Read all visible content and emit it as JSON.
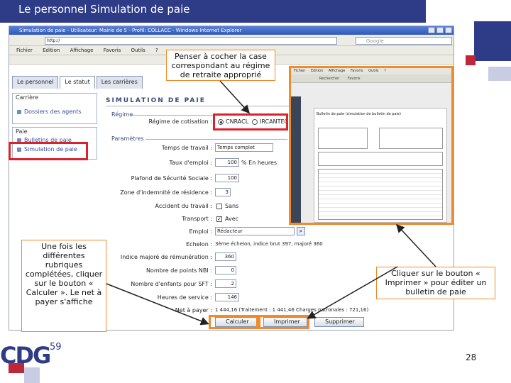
{
  "slide": {
    "title": "Le personnel  Simulation de paie",
    "page_number": "28"
  },
  "browser": {
    "window_title": "Simulation de paie - Utilisateur: Mairie de 5 - Profil: COLLACC - Windows Internet Explorer",
    "address": "http://",
    "search_placeholder": "Google",
    "menu": [
      "Fichier",
      "Edition",
      "Affichage",
      "Favoris",
      "Outils",
      "?"
    ]
  },
  "tabs": [
    "Le personnel",
    "Le statut",
    "Les carrières"
  ],
  "sidebar": {
    "carriere_legend": "Carrière",
    "carriere_link": "Dossiers des agents",
    "paie_legend": "Paie",
    "paie_link1": "Bulletins de paie",
    "paie_link2": "Simulation de paie"
  },
  "form": {
    "main_title": "SIMULATION DE PAIE",
    "regime_section": "Régime",
    "regime_label": "Régime de cotisation :",
    "regime_options": [
      "CNRACL",
      "IRCANTEC"
    ],
    "params_section": "Paramètres",
    "fields": {
      "temps_travail": {
        "label": "Temps de travail :",
        "value": "Temps complet"
      },
      "taux_emploi": {
        "label": "Taux d'emploi :",
        "value": "100",
        "suffix": "% En heures"
      },
      "plafond": {
        "label": "Plafond de Sécurité Sociale :",
        "value": "100"
      },
      "zone": {
        "label": "Zone d'indemnité de résidence :",
        "value": "3"
      },
      "accident": {
        "label": "Accident du travail :",
        "value": "Sans"
      },
      "transport": {
        "label": "Transport :",
        "value": "Avec"
      },
      "emploi": {
        "label": "Emploi :",
        "value": "Rédacteur"
      },
      "echelon": {
        "label": "Echelon :",
        "value": "3ème échelon, indice brut 397, majoré 360"
      },
      "indice": {
        "label": "Indice majoré de rémunération :",
        "value": "360"
      },
      "nbi": {
        "label": "Nombre de points NBI :",
        "value": "0"
      },
      "enfants": {
        "label": "Nombre d'enfants pour SFT :",
        "value": "2"
      },
      "heures": {
        "label": "Heures de service :",
        "value": "146"
      }
    },
    "net_label": "Net à payer :",
    "net_value": "1 444,16 (Traitement : 1 441,46 Charges patronales : 721,16)",
    "buttons": {
      "calculer": "Calculer",
      "imprimer": "Imprimer",
      "supprimer": "Supprimer"
    }
  },
  "preview": {
    "menu": [
      "Fichier",
      "Edition",
      "Affichage",
      "Favoris",
      "Outils",
      "?"
    ],
    "toolbar": [
      "Rechercher",
      "Favoris"
    ],
    "doc_title": "Bulletin de paie (simulation de bulletin de paie)"
  },
  "callouts": {
    "top": "Penser à cocher la case correspondant au régime de retraite approprié",
    "left": "Une fois les différentes rubriques complétées, cliquer sur le bouton « Calculer ». Le net à payer s'affiche",
    "right": "Cliquer sur le bouton « Imprimer » pour éditer un bulletin de paie"
  },
  "logo": {
    "text": "CDG",
    "superscript": "59"
  },
  "colors": {
    "brand_blue": "#2e3b87",
    "accent_red": "#d9232b",
    "accent_orange": "#f08a2a"
  }
}
